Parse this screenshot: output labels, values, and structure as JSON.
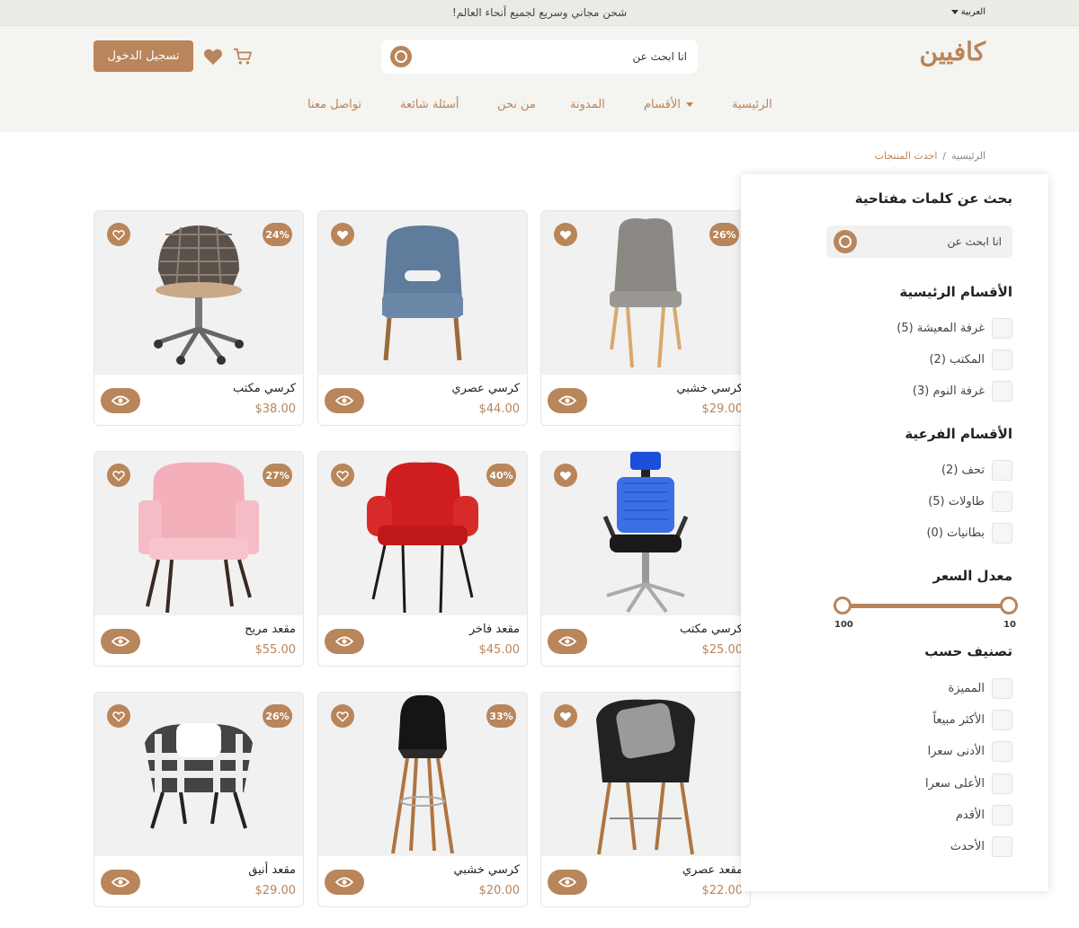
{
  "topbar": {
    "promo": "شحن مجاني وسريع لجميع أنحاء العالم!",
    "language": "العربية"
  },
  "header": {
    "logo": "كافيين",
    "search_placeholder": "انا ابحث عن",
    "login_label": "تسجيل الدخول",
    "nav": [
      "الرئيسية",
      "الأقسام",
      "المدونة",
      "من نحن",
      "أسئلة شائعة",
      "تواصل معنا"
    ]
  },
  "breadcrumb": {
    "home": "الرئيسية",
    "separator": "/",
    "current": "احدث المنتجات"
  },
  "products": [
    {
      "name": "كرسي مكتب",
      "price": "$38.00",
      "discount": "24%"
    },
    {
      "name": "كرسي عصري",
      "price": "$44.00",
      "discount": ""
    },
    {
      "name": "كرسي خشبي",
      "price": "$29.00",
      "discount": "26%"
    },
    {
      "name": "مقعد مريح",
      "price": "$55.00",
      "discount": "27%"
    },
    {
      "name": "مقعد فاخر",
      "price": "$45.00",
      "discount": "40%"
    },
    {
      "name": "كرسي مكتب",
      "price": "$25.00",
      "discount": ""
    },
    {
      "name": "مقعد أنيق",
      "price": "$29.00",
      "discount": "26%"
    },
    {
      "name": "كرسي خشبي",
      "price": "$20.00",
      "discount": "33%"
    },
    {
      "name": "مقعد عصري",
      "price": "$22.00",
      "discount": ""
    }
  ],
  "sidebar": {
    "keyword_title": "بحث عن كلمات مفتاحية",
    "keyword_placeholder": "انا ابحث عن",
    "main_title": "الأقسام الرئيسية",
    "main_cats": [
      "غرفة المعيشة (5)",
      "المكتب (2)",
      "غرفة النوم (3)"
    ],
    "sub_title": "الأقسام الفرعية",
    "sub_cats": [
      "تحف (2)",
      "طاولات (5)",
      "بطانيات (0)"
    ],
    "price_title": "معدل السعر",
    "price_min": "10",
    "price_max": "100",
    "sort_title": "تصنيف حسب",
    "sort_opts": [
      "المميزة",
      "الأكثر مبيعاً",
      "الأدنى سعرا",
      "الأعلى سعرا",
      "الأقدم",
      "الأحدث"
    ]
  },
  "colors": {
    "accent": "#b9855a",
    "header_bg": "#f4f4f1",
    "topbar_bg": "#ebebe6",
    "card_bg": "#f1f1f1"
  }
}
